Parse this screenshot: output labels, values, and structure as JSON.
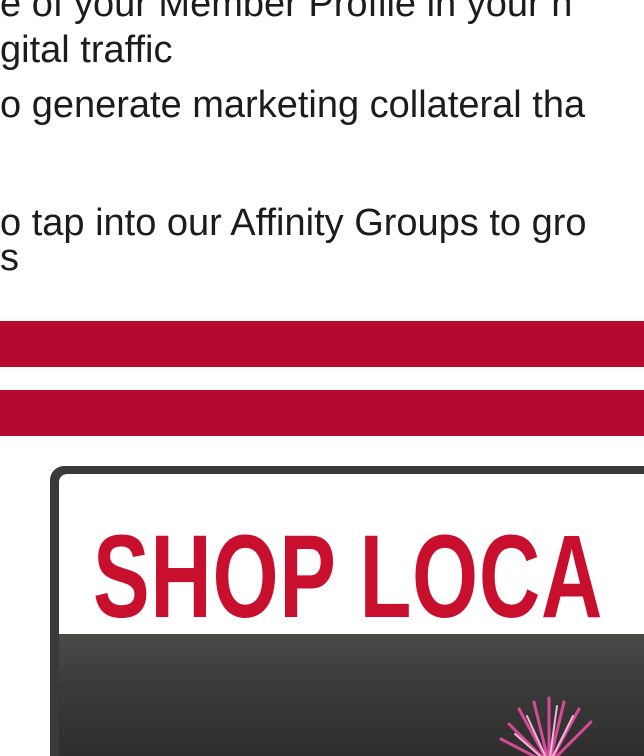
{
  "text_lines": [
    "e of your Member Profile in your n",
    "gital traffic",
    "o generate marketing collateral tha",
    "o tap into our Affinity Groups to gro",
    "s"
  ],
  "sign": {
    "text": "SHOP LOCA"
  },
  "colors": {
    "accent": "#b5092f",
    "sign_text": "#c8102e"
  },
  "icons": [
    "flower-image"
  ]
}
